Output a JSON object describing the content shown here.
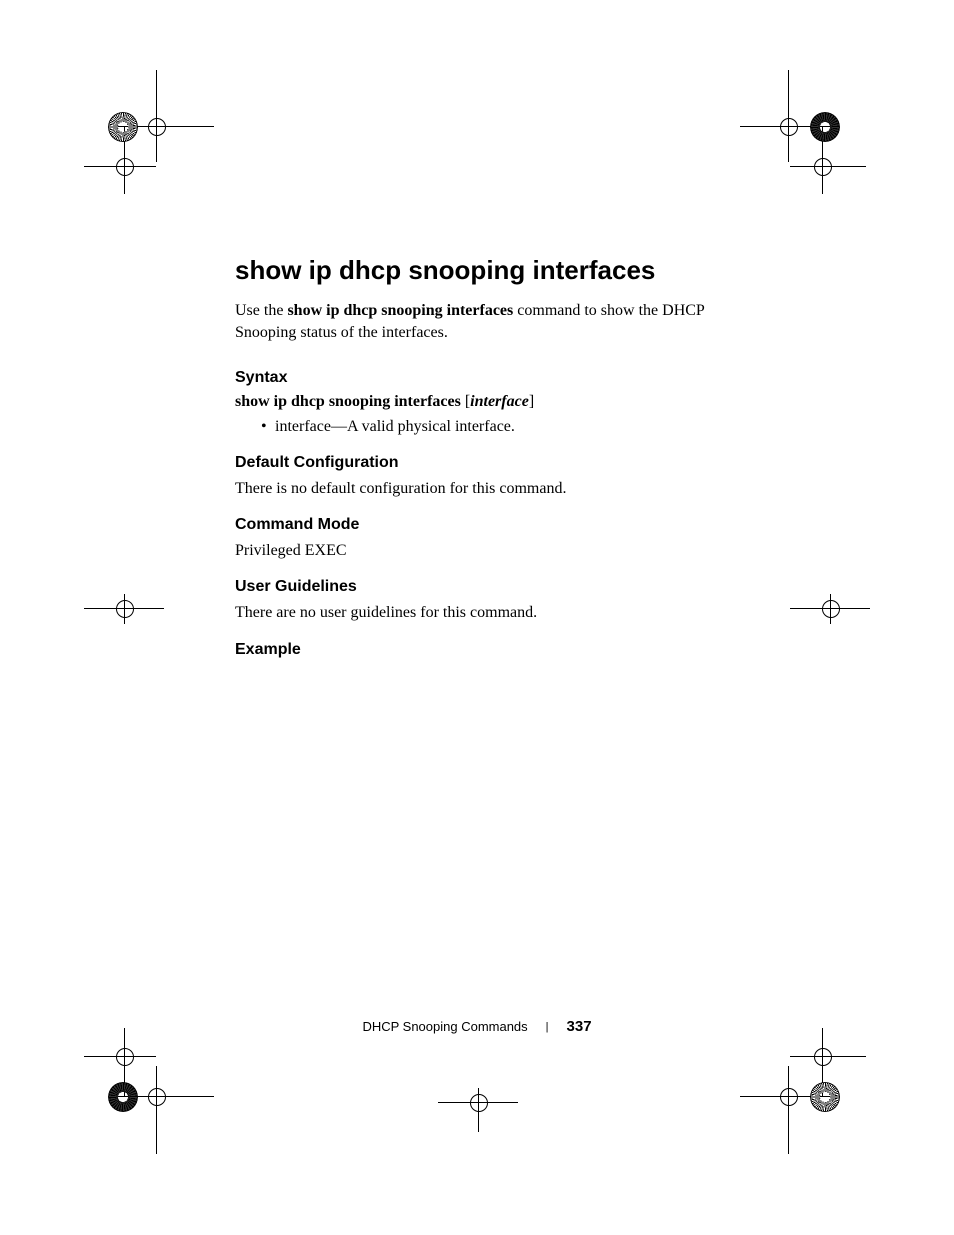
{
  "title": "show ip dhcp snooping interfaces",
  "intro_pre": "Use the ",
  "intro_bold": "show ip dhcp snooping interfaces",
  "intro_post": " command to show the DHCP Snooping status of the interfaces.",
  "sections": {
    "syntax": {
      "head": "Syntax",
      "cmd_bold": "show ip dhcp snooping interfaces",
      "cmd_open": " [",
      "cmd_italic": "interface",
      "cmd_close": "]",
      "bullet": "interface—A valid physical interface."
    },
    "default": {
      "head": "Default Configuration",
      "body": "There is no default configuration for this command."
    },
    "mode": {
      "head": "Command Mode",
      "body": "Privileged EXEC"
    },
    "guidelines": {
      "head": "User Guidelines",
      "body": "There are no user guidelines for this command."
    },
    "example": {
      "head": "Example"
    }
  },
  "footer": {
    "section": "DHCP Snooping Commands",
    "page": "337"
  }
}
